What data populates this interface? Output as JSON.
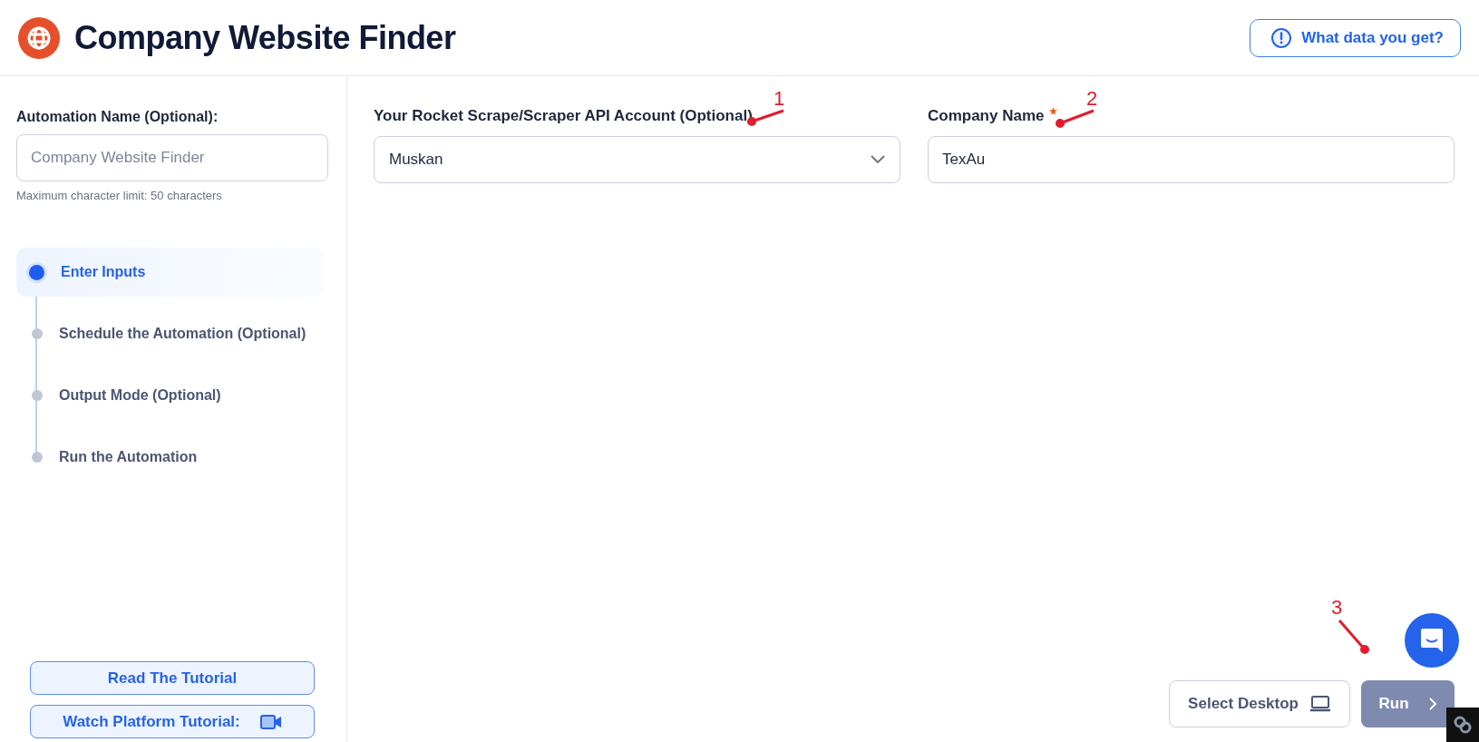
{
  "header": {
    "title": "Company Website Finder",
    "help_button": "What data you get?"
  },
  "sidebar": {
    "automation_name": {
      "label": "Automation Name (Optional):",
      "placeholder": "Company Website Finder",
      "hint": "Maximum character limit: 50 characters"
    },
    "steps": [
      {
        "label": "Enter Inputs",
        "selected": true
      },
      {
        "label": "Schedule the Automation (Optional)",
        "selected": false
      },
      {
        "label": "Output Mode (Optional)",
        "selected": false
      },
      {
        "label": "Run the Automation",
        "selected": false
      }
    ],
    "buttons": [
      {
        "label": "Read The Tutorial",
        "kind": "plain"
      },
      {
        "label": "Watch Platform Tutorial:",
        "kind": "video"
      }
    ]
  },
  "form": {
    "fields": [
      {
        "label": "Your Rocket Scrape/Scraper API Account (Optional)",
        "kind": "select",
        "value": "Muskan",
        "required": false
      },
      {
        "label": "Company Name",
        "kind": "text",
        "value": "TexAu",
        "required": true
      }
    ]
  },
  "actions": {
    "select_desktop": "Select Desktop",
    "run": {
      "label": "Run",
      "disabled": true
    }
  },
  "annotations": [
    {
      "number": "1"
    },
    {
      "number": "2"
    },
    {
      "number": "3"
    }
  ]
}
